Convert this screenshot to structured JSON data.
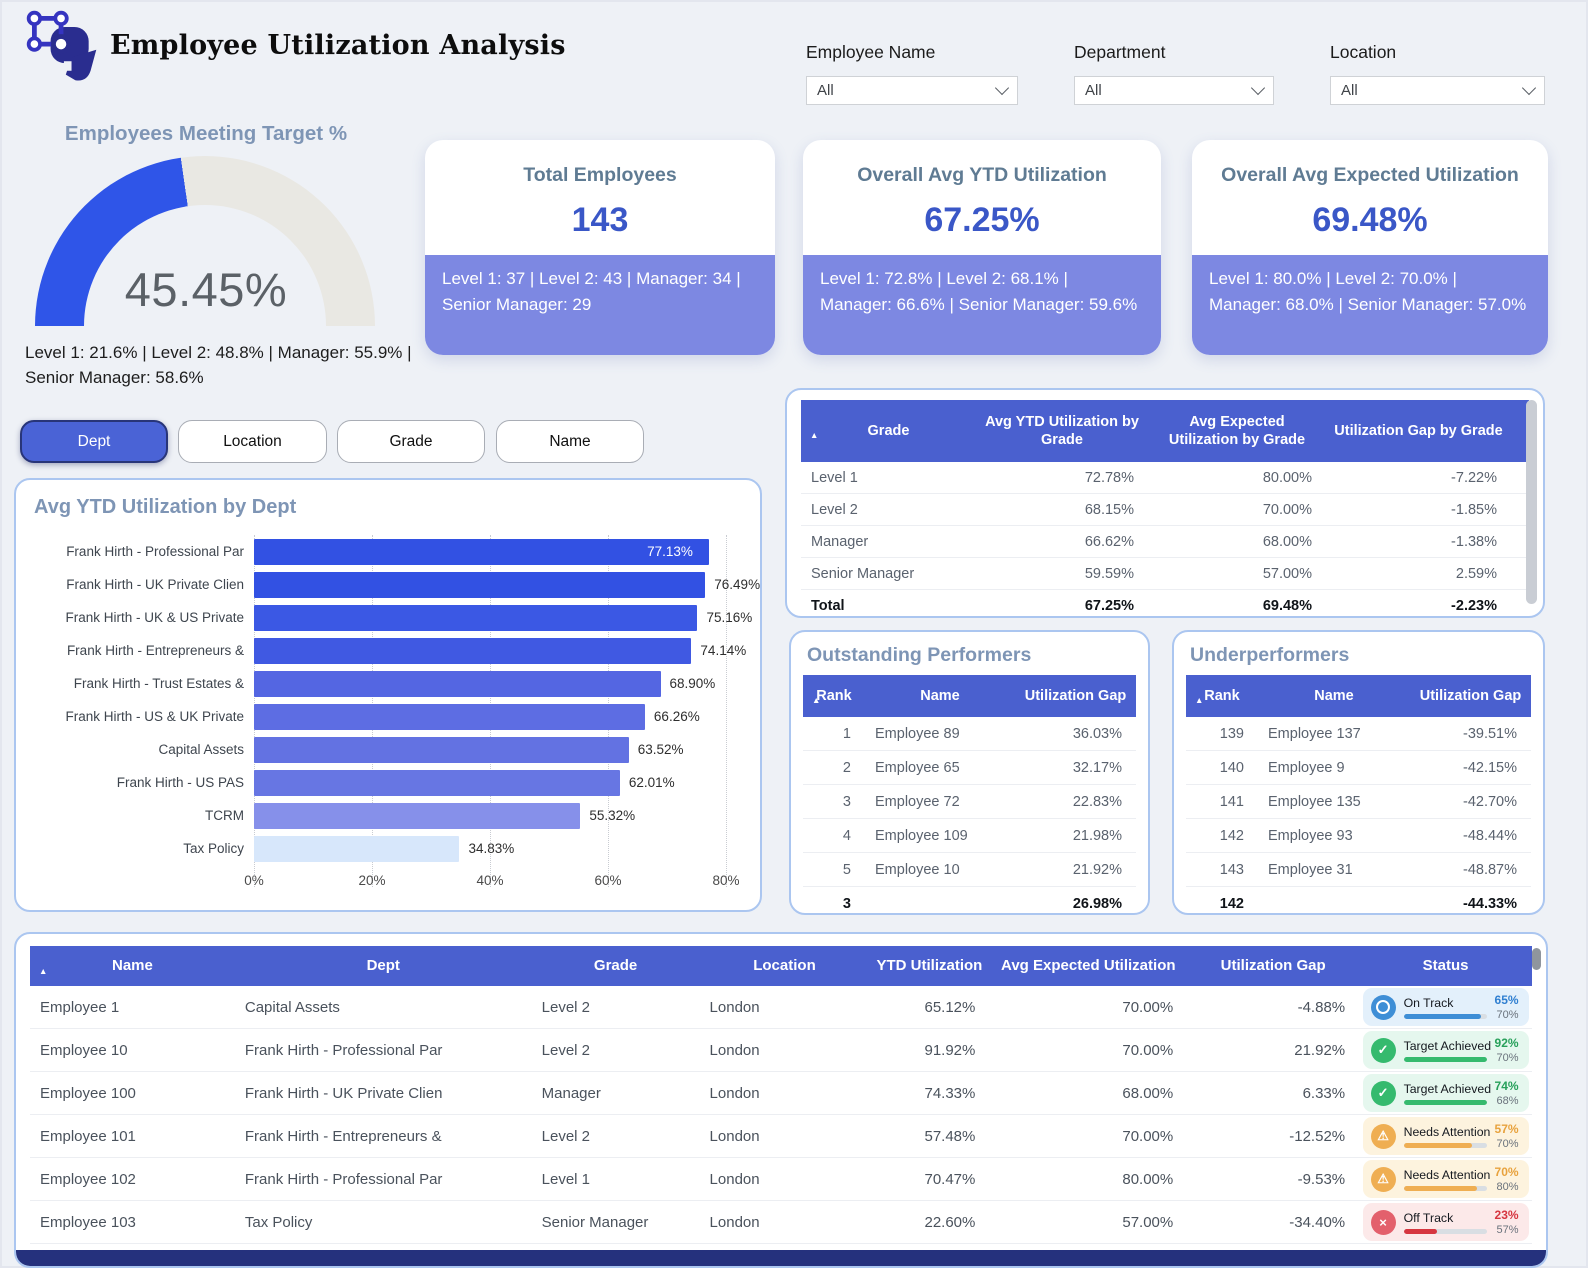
{
  "app": {
    "title": "Employee Utilization Analysis",
    "logo_icon": "network-graph-icon"
  },
  "colors": {
    "header_blue": "#4a60cf",
    "active_button": "#4a63d6",
    "kpi_value_blue": "#3a57c7",
    "kpi_sub_bg": "#7d88e2",
    "panel_border": "#abc6f0",
    "page_bg": "#eef1f6",
    "section_title": "#7e95b5",
    "gauge_fill": "#2f55e8",
    "gauge_track": "#e9e8e3",
    "status_on_track": "#3e8ed6",
    "status_achieved": "#35ba6e",
    "status_attention": "#efae52",
    "status_off_track": "#d63640"
  },
  "filters": [
    {
      "label": "Employee Name",
      "value": "All",
      "icon": "chevron-down-icon"
    },
    {
      "label": "Department",
      "value": "All",
      "icon": "chevron-down-icon"
    },
    {
      "label": "Location",
      "value": "All",
      "icon": "chevron-down-icon"
    }
  ],
  "gauge": {
    "title": "Employees Meeting Target %",
    "value": "45.45%",
    "percent": 45.45,
    "breakdown": "Level 1: 21.6%  |  Level 2: 48.8%  |  Manager: 55.9%  |  Senior Manager: 58.6%"
  },
  "kpis": [
    {
      "title": "Total Employees",
      "value": "143",
      "breakdown": "Level 1: 37 | Level 2: 43 | Manager: 34 | Senior Manager: 29"
    },
    {
      "title": "Overall Avg YTD Utilization",
      "value": "67.25%",
      "breakdown": "Level 1: 72.8% | Level 2: 68.1% | Manager: 66.6% | Senior Manager: 59.6%"
    },
    {
      "title": "Overall Avg Expected Utilization",
      "value": "69.48%",
      "breakdown": "Level 1: 80.0% | Level 2: 70.0% | Manager: 68.0% | Senior Manager: 57.0%"
    }
  ],
  "view_tabs": [
    {
      "label": "Dept",
      "active": true
    },
    {
      "label": "Location",
      "active": false
    },
    {
      "label": "Grade",
      "active": false
    },
    {
      "label": "Name",
      "active": false
    }
  ],
  "chart_data": {
    "type": "bar",
    "orientation": "horizontal",
    "title": "Avg YTD Utilization by Dept",
    "categories": [
      "Frank Hirth - Professional Par",
      "Frank Hirth - UK Private Clien",
      "Frank Hirth - UK & US Private",
      "Frank Hirth - Entrepreneurs &",
      "Frank Hirth - Trust Estates &",
      "Frank Hirth - US & UK Private",
      "Capital Assets",
      "Frank Hirth - US PAS",
      "TCRM",
      "Tax Policy"
    ],
    "values": [
      77.13,
      76.49,
      75.16,
      74.14,
      68.9,
      66.26,
      63.52,
      62.01,
      55.32,
      34.83
    ],
    "labels": [
      "77.13%",
      "76.49%",
      "75.16%",
      "74.14%",
      "68.90%",
      "66.26%",
      "63.52%",
      "62.01%",
      "55.32%",
      "34.83%"
    ],
    "bar_colors": [
      "#3251e3",
      "#3251e3",
      "#3b58e4",
      "#4059e2",
      "#5466e2",
      "#5d6de3",
      "#6372e2",
      "#6776e3",
      "#8690ea",
      "#d7e7fb"
    ],
    "x_ticks": [
      "0%",
      "20%",
      "40%",
      "60%",
      "80%"
    ],
    "x_tick_values": [
      0,
      20,
      40,
      60,
      80
    ],
    "xlim": [
      0,
      86
    ],
    "grid": "dotted-vertical"
  },
  "grade_table": {
    "headers": [
      "Grade",
      "Avg YTD Utilization by Grade",
      "Avg Expected Utilization by Grade",
      "Utilization Gap by Grade"
    ],
    "sort_column": "Grade",
    "rows": [
      [
        "Level 1",
        "72.78%",
        "80.00%",
        "-7.22%"
      ],
      [
        "Level 2",
        "68.15%",
        "70.00%",
        "-1.85%"
      ],
      [
        "Manager",
        "66.62%",
        "68.00%",
        "-1.38%"
      ],
      [
        "Senior Manager",
        "59.59%",
        "57.00%",
        "2.59%"
      ]
    ],
    "total": [
      "Total",
      "67.25%",
      "69.48%",
      "-2.23%"
    ]
  },
  "outstanding_performers": {
    "title": "Outstanding Performers",
    "headers": [
      "Rank",
      "Name",
      "Utilization Gap"
    ],
    "rows": [
      [
        "1",
        "Employee 89",
        "36.03%"
      ],
      [
        "2",
        "Employee 65",
        "32.17%"
      ],
      [
        "3",
        "Employee 72",
        "22.83%"
      ],
      [
        "4",
        "Employee 109",
        "21.98%"
      ],
      [
        "5",
        "Employee 10",
        "21.92%"
      ]
    ],
    "total": [
      "3",
      "",
      "26.98%"
    ]
  },
  "underperformers": {
    "title": "Underperformers",
    "headers": [
      "Rank",
      "Name",
      "Utilization Gap"
    ],
    "rows": [
      [
        "139",
        "Employee 137",
        "-39.51%"
      ],
      [
        "140",
        "Employee 9",
        "-42.15%"
      ],
      [
        "141",
        "Employee 135",
        "-42.70%"
      ],
      [
        "142",
        "Employee 93",
        "-48.44%"
      ],
      [
        "143",
        "Employee 31",
        "-48.87%"
      ]
    ],
    "total": [
      "142",
      "",
      "-44.33%"
    ]
  },
  "employee_table": {
    "headers": [
      "Name",
      "Dept",
      "Grade",
      "Location",
      "YTD Utilization",
      "Avg Expected Utilization",
      "Utilization Gap",
      "Status"
    ],
    "sort_column": "Name",
    "rows": [
      {
        "name": "Employee 1",
        "dept": "Capital Assets",
        "grade": "Level 2",
        "location": "London",
        "ytd": "65.12%",
        "expected": "70.00%",
        "gap": "-4.88%",
        "status": {
          "label": "On Track",
          "kind": "on-track",
          "icon": "circle-outline-icon",
          "current": "65%",
          "target": "70%",
          "progress": 93
        }
      },
      {
        "name": "Employee 10",
        "dept": "Frank Hirth - Professional Par",
        "grade": "Level 2",
        "location": "London",
        "ytd": "91.92%",
        "expected": "70.00%",
        "gap": "21.92%",
        "status": {
          "label": "Target Achieved",
          "kind": "achieved",
          "icon": "check-icon",
          "current": "92%",
          "target": "70%",
          "progress": 100
        }
      },
      {
        "name": "Employee 100",
        "dept": "Frank Hirth - UK Private Clien",
        "grade": "Manager",
        "location": "London",
        "ytd": "74.33%",
        "expected": "68.00%",
        "gap": "6.33%",
        "status": {
          "label": "Target Achieved",
          "kind": "achieved",
          "icon": "check-icon",
          "current": "74%",
          "target": "68%",
          "progress": 100
        }
      },
      {
        "name": "Employee 101",
        "dept": "Frank Hirth - Entrepreneurs &",
        "grade": "Level 2",
        "location": "London",
        "ytd": "57.48%",
        "expected": "70.00%",
        "gap": "-12.52%",
        "status": {
          "label": "Needs Attention",
          "kind": "attention",
          "icon": "warning-icon",
          "current": "57%",
          "target": "70%",
          "progress": 82
        }
      },
      {
        "name": "Employee 102",
        "dept": "Frank Hirth - Professional Par",
        "grade": "Level 1",
        "location": "London",
        "ytd": "70.47%",
        "expected": "80.00%",
        "gap": "-9.53%",
        "status": {
          "label": "Needs Attention",
          "kind": "attention",
          "icon": "warning-icon",
          "current": "70%",
          "target": "80%",
          "progress": 88
        }
      },
      {
        "name": "Employee 103",
        "dept": "Tax Policy",
        "grade": "Senior Manager",
        "location": "London",
        "ytd": "22.60%",
        "expected": "57.00%",
        "gap": "-34.40%",
        "status": {
          "label": "Off Track",
          "kind": "off-track",
          "icon": "x-icon",
          "current": "23%",
          "target": "57%",
          "progress": 40
        }
      }
    ]
  }
}
